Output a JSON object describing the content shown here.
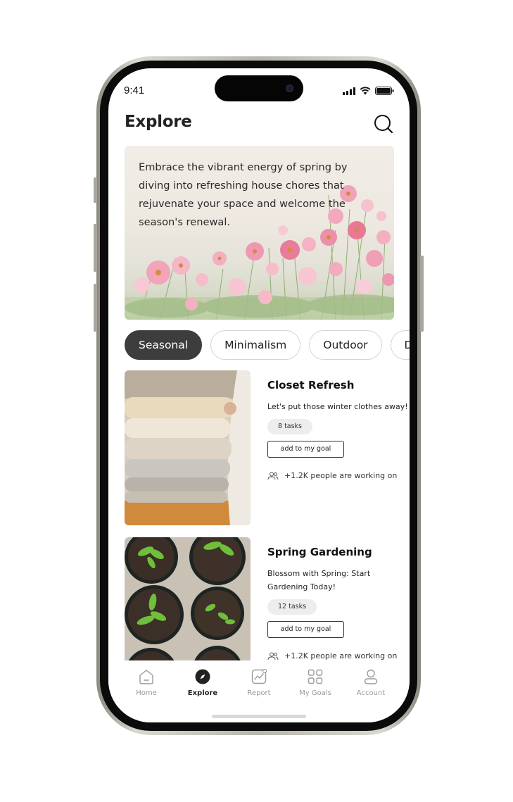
{
  "status_bar": {
    "time": "9:41"
  },
  "header": {
    "title": "Explore"
  },
  "hero": {
    "text": "Embrace the vibrant energy of spring by diving into refreshing house chores that rejuvenate your space and welcome the season's renewal."
  },
  "categories": [
    {
      "label": "Seasonal",
      "active": true
    },
    {
      "label": "Minimalism",
      "active": false
    },
    {
      "label": "Outdoor",
      "active": false
    },
    {
      "label": "Du",
      "active": false
    }
  ],
  "cards": [
    {
      "title": "Closet Refresh",
      "description": "Let's put those winter clothes away!",
      "tasks": "8 tasks",
      "button": "add to my goal",
      "people": "+1.2K people are working on"
    },
    {
      "title": "Spring Gardening",
      "description": "Blossom with Spring: Start Gardening Today!",
      "tasks": "12 tasks",
      "button": "add to my goal",
      "people": "+1.2K people are working on"
    }
  ],
  "tabs": [
    {
      "label": "Home",
      "icon": "home-icon"
    },
    {
      "label": "Explore",
      "icon": "compass-icon",
      "active": true
    },
    {
      "label": "Report",
      "icon": "chart-icon"
    },
    {
      "label": "My Goals",
      "icon": "grid-icon"
    },
    {
      "label": "Account",
      "icon": "user-icon"
    }
  ],
  "colors": {
    "accent": "#3d3d3d",
    "badge_bg": "#ededed",
    "inactive_tab": "#999999"
  }
}
